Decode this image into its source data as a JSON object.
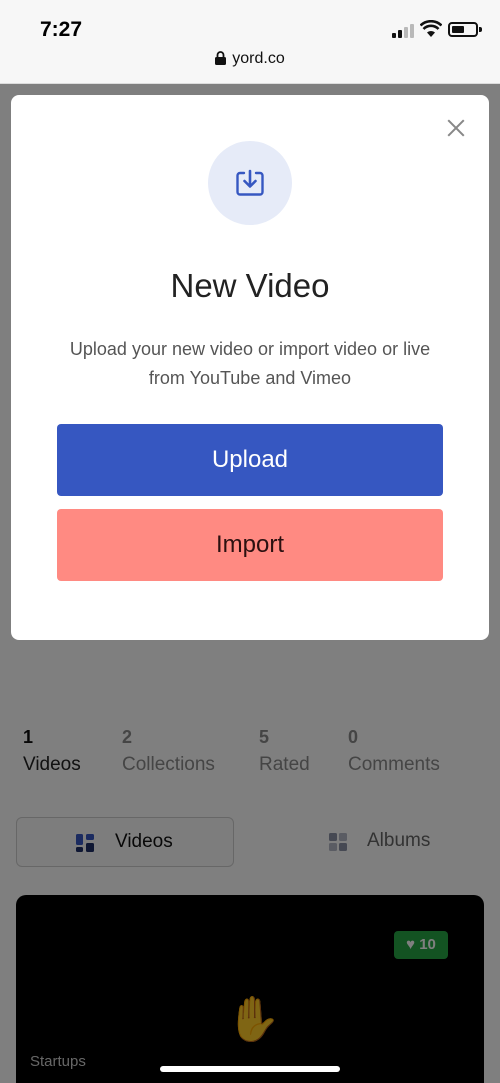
{
  "status": {
    "time": "7:27"
  },
  "browser": {
    "url": "yord.co"
  },
  "modal": {
    "title": "New Video",
    "description": "Upload your new video or import video or live from YouTube and Vimeo",
    "upload_label": "Upload",
    "import_label": "Import",
    "icon": "download-tray-icon"
  },
  "stats": [
    {
      "count": "1",
      "label": "Videos"
    },
    {
      "count": "2",
      "label": "Collections"
    },
    {
      "count": "5",
      "label": "Rated"
    },
    {
      "count": "0",
      "label": "Comments"
    }
  ],
  "view_toggle": {
    "videos_label": "Videos",
    "albums_label": "Albums"
  },
  "video_card": {
    "likes": "10",
    "category": "Startups"
  },
  "colors": {
    "primary": "#3657c1",
    "secondary": "#ff8a82",
    "likes": "#27a745"
  }
}
